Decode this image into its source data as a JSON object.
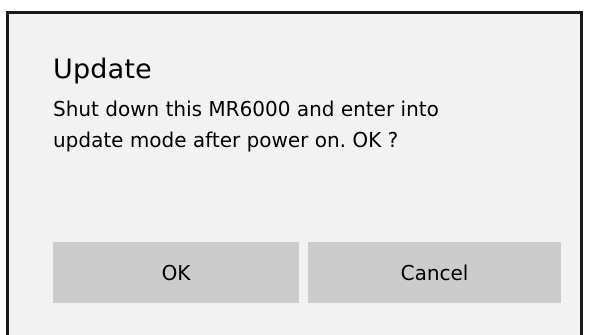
{
  "dialog": {
    "title": "Update",
    "message_lines": [
      "Shut down this MR6000 and enter into",
      "update mode after power on.  OK ?"
    ],
    "buttons": {
      "ok_label": "OK",
      "cancel_label": "Cancel"
    }
  }
}
